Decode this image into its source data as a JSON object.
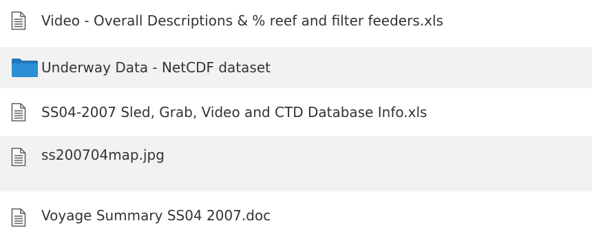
{
  "files": [
    {
      "name": "Video - Overall Descriptions & % reef and filter feeders.xls",
      "icon": "document-icon"
    },
    {
      "name": "Underway Data - NetCDF dataset",
      "icon": "folder-icon"
    },
    {
      "name": "SS04-2007 Sled, Grab, Video and CTD Database Info.xls",
      "icon": "document-icon"
    },
    {
      "name": "ss200704map.jpg",
      "icon": "document-icon"
    },
    {
      "name": "Voyage Summary SS04 2007.doc",
      "icon": "document-icon"
    }
  ],
  "colors": {
    "text": "#333333",
    "row_shade": "#f2f2f2",
    "folder": "#2a86c8"
  }
}
